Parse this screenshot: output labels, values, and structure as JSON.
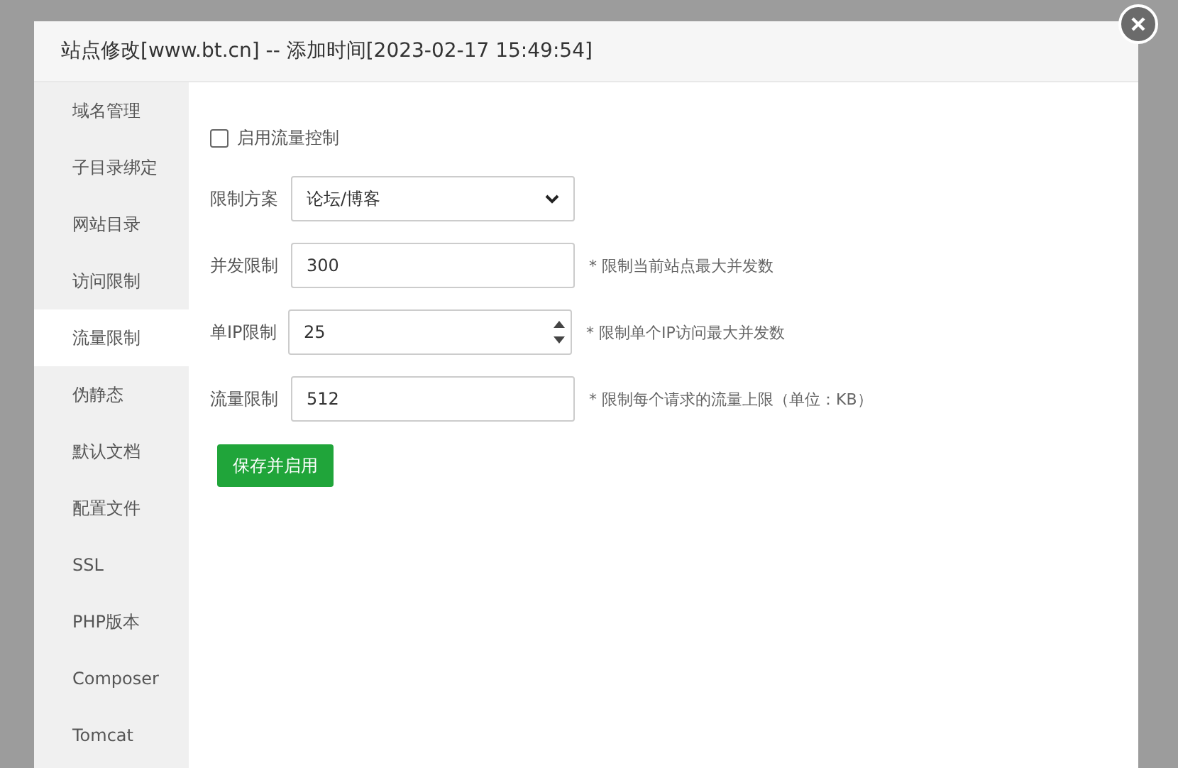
{
  "window": {
    "title": "站点修改[www.bt.cn] -- 添加时间[2023-02-17 15:49:54]"
  },
  "sidebar": {
    "items": [
      {
        "label": "域名管理",
        "selected": false
      },
      {
        "label": "子目录绑定",
        "selected": false
      },
      {
        "label": "网站目录",
        "selected": false
      },
      {
        "label": "访问限制",
        "selected": false
      },
      {
        "label": "流量限制",
        "selected": true
      },
      {
        "label": "伪静态",
        "selected": false
      },
      {
        "label": "默认文档",
        "selected": false
      },
      {
        "label": "配置文件",
        "selected": false
      },
      {
        "label": "SSL",
        "selected": false
      },
      {
        "label": "PHP版本",
        "selected": false
      },
      {
        "label": "Composer",
        "selected": false
      },
      {
        "label": "Tomcat",
        "selected": false
      }
    ]
  },
  "enable": {
    "label": "启用流量控制",
    "checked": false
  },
  "fields": [
    {
      "kind": "select",
      "label": "限制方案",
      "value": "论坛/博客"
    },
    {
      "kind": "text",
      "label": "并发限制",
      "value": "300",
      "hint": "* 限制当前站点最大并发数"
    },
    {
      "kind": "number",
      "label": "单IP限制",
      "value": "25",
      "hint": "* 限制单个IP访问最大并发数"
    },
    {
      "kind": "text",
      "label": "流量限制",
      "value": "512",
      "hint": "* 限制每个请求的流量上限（单位：KB）"
    }
  ],
  "save_button": "保存并启用"
}
